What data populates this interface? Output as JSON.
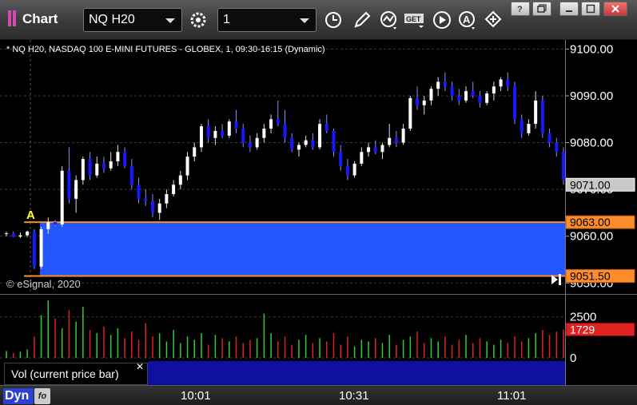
{
  "window": {
    "title": "Chart",
    "symbol": "NQ H20",
    "interval": "1"
  },
  "chart": {
    "description": "* NQ H20, NASDAQ 100 E-MINI FUTURES - GLOBEX, 1, 09:30-16:15 (Dynamic)",
    "copyright": "© eSignal, 2020",
    "annotation_label": "A",
    "colors": {
      "up": "#ffffff",
      "down": "#1818ff",
      "zone": "#2457ff",
      "zone_line": "#ff8c2a",
      "last_price_bg": "#c8c8c8",
      "vol_up": "#33cc33",
      "vol_down": "#dd2222"
    }
  },
  "chart_data": {
    "type": "candlestick",
    "price_axis": {
      "ticks": [
        "9100.00",
        "9090.00",
        "9080.00",
        "9070.00",
        "9060.00",
        "9050.00"
      ],
      "ylim": [
        9048.0,
        9101.6
      ]
    },
    "zone": {
      "high": 9063.0,
      "low": 9051.5
    },
    "price_labels": [
      {
        "value": 9071.0,
        "text": "9071.00",
        "style": "last"
      },
      {
        "value": 9063.0,
        "text": "9063.00",
        "style": "zone"
      },
      {
        "value": 9051.5,
        "text": "9051.50",
        "style": "zone"
      }
    ],
    "time_axis": [
      "10:01",
      "10:31",
      "11:01"
    ],
    "volume_axis": {
      "ticks": [
        "2500",
        "0"
      ],
      "ylim": [
        0,
        3500
      ]
    },
    "volume_label": {
      "value": 1729,
      "text": "1729"
    },
    "candles": [
      [
        9060.5,
        9061.0,
        9060.0,
        9060.6
      ],
      [
        9060.6,
        9061.0,
        9059.8,
        9059.9
      ],
      [
        9059.9,
        9060.8,
        9059.6,
        9060.2
      ],
      [
        9060.2,
        9061.2,
        9059.8,
        9061.0
      ],
      [
        9061.0,
        9061.5,
        9053.0,
        9053.5
      ],
      [
        9053.5,
        9062.0,
        9053.0,
        9061.5
      ],
      [
        9061.5,
        9064.0,
        9060.5,
        9063.0
      ],
      [
        9063.0,
        9063.5,
        9062.0,
        9062.5
      ],
      [
        9062.5,
        9075.0,
        9062.0,
        9074.0
      ],
      [
        9074.0,
        9079.0,
        9067.0,
        9068.0
      ],
      [
        9068.0,
        9073.0,
        9065.0,
        9072.0
      ],
      [
        9072.0,
        9077.0,
        9071.0,
        9076.5
      ],
      [
        9076.5,
        9078.0,
        9072.0,
        9073.0
      ],
      [
        9073.0,
        9077.0,
        9072.5,
        9075.5
      ],
      [
        9075.5,
        9077.0,
        9073.5,
        9074.5
      ],
      [
        9074.5,
        9078.0,
        9074.0,
        9076.0
      ],
      [
        9076.0,
        9079.5,
        9075.0,
        9078.0
      ],
      [
        9078.0,
        9079.0,
        9074.5,
        9075.0
      ],
      [
        9075.0,
        9076.5,
        9070.0,
        9071.0
      ],
      [
        9071.0,
        9072.5,
        9067.0,
        9068.0
      ],
      [
        9068.0,
        9070.0,
        9066.5,
        9067.5
      ],
      [
        9067.5,
        9069.0,
        9064.0,
        9065.0
      ],
      [
        9065.0,
        9068.0,
        9063.5,
        9067.0
      ],
      [
        9067.0,
        9070.0,
        9066.0,
        9069.0
      ],
      [
        9069.0,
        9072.0,
        9068.5,
        9071.0
      ],
      [
        9071.0,
        9074.0,
        9070.0,
        9073.0
      ],
      [
        9073.0,
        9078.0,
        9072.0,
        9077.0
      ],
      [
        9077.0,
        9080.0,
        9076.0,
        9079.0
      ],
      [
        9079.0,
        9084.0,
        9078.0,
        9083.5
      ],
      [
        9083.5,
        9085.0,
        9080.0,
        9081.0
      ],
      [
        9081.0,
        9083.5,
        9079.5,
        9082.5
      ],
      [
        9082.5,
        9084.0,
        9081.0,
        9081.5
      ],
      [
        9081.5,
        9085.0,
        9081.0,
        9084.5
      ],
      [
        9084.5,
        9087.0,
        9082.0,
        9083.0
      ],
      [
        9083.0,
        9084.0,
        9079.0,
        9080.0
      ],
      [
        9080.0,
        9081.5,
        9078.0,
        9079.0
      ],
      [
        9079.0,
        9082.0,
        9078.5,
        9081.0
      ],
      [
        9081.0,
        9084.0,
        9080.0,
        9083.0
      ],
      [
        9083.0,
        9086.0,
        9082.0,
        9085.0
      ],
      [
        9085.0,
        9089.0,
        9083.5,
        9084.0
      ],
      [
        9084.0,
        9087.0,
        9080.0,
        9081.0
      ],
      [
        9081.0,
        9082.0,
        9078.0,
        9078.5
      ],
      [
        9078.5,
        9080.0,
        9077.0,
        9079.5
      ],
      [
        9079.5,
        9081.5,
        9079.0,
        9080.5
      ],
      [
        9080.5,
        9082.0,
        9078.5,
        9079.0
      ],
      [
        9079.0,
        9085.0,
        9078.5,
        9084.0
      ],
      [
        9084.0,
        9086.0,
        9082.0,
        9082.5
      ],
      [
        9082.5,
        9083.0,
        9077.0,
        9078.0
      ],
      [
        9078.0,
        9079.5,
        9074.0,
        9075.0
      ],
      [
        9075.0,
        9076.5,
        9072.0,
        9073.0
      ],
      [
        9073.0,
        9076.0,
        9072.5,
        9075.5
      ],
      [
        9075.5,
        9079.0,
        9075.0,
        9078.0
      ],
      [
        9078.0,
        9080.0,
        9077.0,
        9079.0
      ],
      [
        9079.0,
        9080.5,
        9077.5,
        9078.0
      ],
      [
        9078.0,
        9080.0,
        9076.5,
        9079.5
      ],
      [
        9079.5,
        9084.0,
        9079.0,
        9081.0
      ],
      [
        9081.0,
        9082.5,
        9079.0,
        9080.0
      ],
      [
        9080.0,
        9084.0,
        9079.5,
        9083.0
      ],
      [
        9083.0,
        9090.0,
        9082.5,
        9089.5
      ],
      [
        9089.5,
        9092.0,
        9087.0,
        9088.0
      ],
      [
        9088.0,
        9090.0,
        9086.0,
        9089.0
      ],
      [
        9089.0,
        9092.0,
        9088.0,
        9091.5
      ],
      [
        9091.5,
        9094.0,
        9090.0,
        9093.0
      ],
      [
        9093.0,
        9095.0,
        9091.0,
        9092.0
      ],
      [
        9092.0,
        9093.0,
        9089.0,
        9090.0
      ],
      [
        9090.0,
        9091.5,
        9088.0,
        9089.0
      ],
      [
        9089.0,
        9092.0,
        9088.5,
        9091.0
      ],
      [
        9091.0,
        9093.0,
        9089.5,
        9090.0
      ],
      [
        9090.0,
        9091.0,
        9087.5,
        9088.5
      ],
      [
        9088.5,
        9091.0,
        9088.0,
        9090.5
      ],
      [
        9090.5,
        9093.0,
        9089.0,
        9092.0
      ],
      [
        9092.0,
        9094.0,
        9091.0,
        9093.5
      ],
      [
        9093.5,
        9095.0,
        9091.0,
        9092.0
      ],
      [
        9092.0,
        9093.0,
        9084.0,
        9085.0
      ],
      [
        9085.0,
        9086.0,
        9081.0,
        9082.0
      ],
      [
        9082.0,
        9085.0,
        9081.5,
        9084.0
      ],
      [
        9084.0,
        9091.0,
        9083.0,
        9089.0
      ],
      [
        9089.0,
        9090.0,
        9081.0,
        9082.0
      ],
      [
        9082.0,
        9083.0,
        9079.0,
        9080.0
      ],
      [
        9080.0,
        9081.0,
        9077.0,
        9078.0
      ],
      [
        9078.0,
        9079.0,
        9071.0,
        9072.0
      ]
    ],
    "volume": [
      420,
      300,
      380,
      520,
      1300,
      2600,
      3500,
      2400,
      1800,
      2900,
      2200,
      3100,
      1700,
      1500,
      1900,
      1400,
      1800,
      1200,
      1600,
      1100,
      2100,
      1300,
      1500,
      1000,
      1700,
      900,
      1300,
      1100,
      1500,
      800,
      1400,
      1200,
      1000,
      1300,
      900,
      1100,
      1200,
      2700,
      1500,
      1000,
      1300,
      800,
      1100,
      1400,
      900,
      1200,
      1000,
      1500,
      800,
      1300,
      700,
      1100,
      1000,
      1200,
      900,
      1400,
      800,
      1100,
      1300,
      1600,
      900,
      1200,
      1000,
      1300,
      800,
      1100,
      1400,
      900,
      1200,
      1000,
      800,
      1100,
      900,
      1300,
      1000,
      1200,
      1500,
      1700,
      1400,
      1600,
      1729
    ],
    "volume_up": [
      true,
      false,
      true,
      true,
      false,
      true,
      true,
      false,
      true,
      false,
      true,
      true,
      false,
      true,
      false,
      true,
      true,
      false,
      false,
      false,
      false,
      false,
      true,
      true,
      true,
      true,
      true,
      true,
      true,
      false,
      true,
      false,
      true,
      false,
      false,
      false,
      true,
      true,
      true,
      false,
      false,
      false,
      true,
      true,
      false,
      true,
      false,
      false,
      false,
      false,
      true,
      true,
      true,
      false,
      true,
      true,
      false,
      true,
      true,
      false,
      false,
      true,
      true,
      false,
      false,
      false,
      true,
      false,
      false,
      true,
      true,
      true,
      false,
      false,
      false,
      true,
      true,
      false,
      false,
      false,
      false
    ]
  }
}
